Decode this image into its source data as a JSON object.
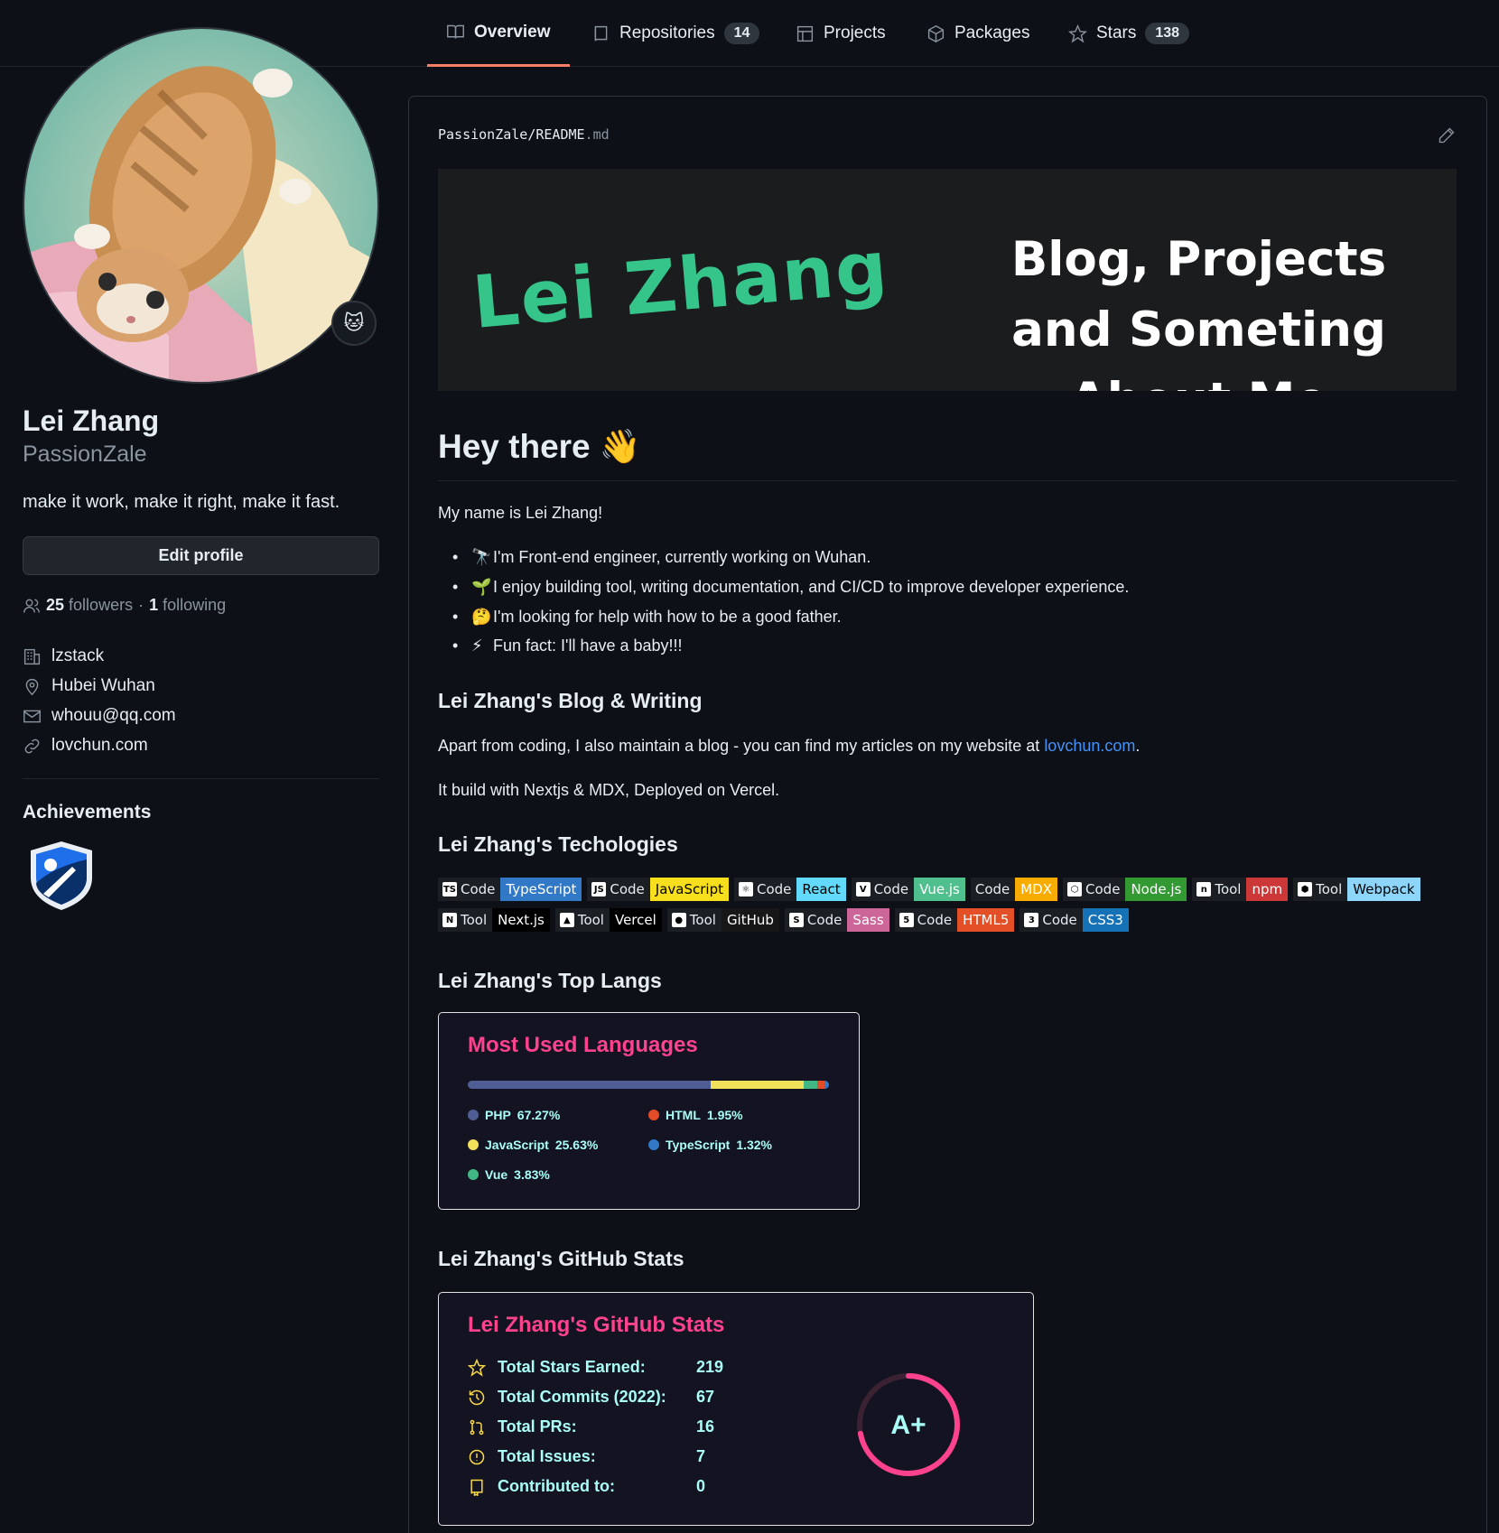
{
  "nav": {
    "tabs": [
      {
        "label": "Overview",
        "count": "",
        "icon": "book-icon",
        "active": true
      },
      {
        "label": "Repositories",
        "count": "14",
        "icon": "repo-icon"
      },
      {
        "label": "Projects",
        "count": "",
        "icon": "table-icon"
      },
      {
        "label": "Packages",
        "count": "",
        "icon": "package-icon"
      },
      {
        "label": "Stars",
        "count": "138",
        "icon": "star-icon"
      }
    ]
  },
  "profile": {
    "full_name": "Lei Zhang",
    "username": "PassionZale",
    "bio": "make it work, make it right, make it fast.",
    "edit_label": "Edit profile",
    "followers_count": "25",
    "followers_label": "followers",
    "separator": "·",
    "following_count": "1",
    "following_label": "following",
    "company": "lzstack",
    "location": "Hubei Wuhan",
    "email": "whouu@qq.com",
    "website": "lovchun.com",
    "achievements_title": "Achievements"
  },
  "readme": {
    "owner": "PassionZale",
    "slash": "/",
    "file": "README",
    "ext": ".md",
    "banner_name": "Lei  Zhang",
    "banner_tagline": "Blog, Projects and Someting About Me",
    "greeting": "Hey there 👋",
    "intro": "My name is Lei Zhang!",
    "bullets": [
      {
        "icon": "🔭",
        "text": "I'm Front-end engineer, currently working on Wuhan."
      },
      {
        "icon": "🌱",
        "text": "I enjoy building tool, writing documentation, and CI/CD to improve developer experience."
      },
      {
        "icon": "🤔",
        "text": "I'm looking for help with how to be a good father."
      },
      {
        "icon": "⚡",
        "text": "Fun fact: I'll have a baby!!!"
      }
    ],
    "blog_heading": "Lei Zhang's Blog & Writing",
    "blog_text_before": "Apart from coding, I also maintain a blog - you can find my articles on my website at ",
    "blog_link": "lovchun.com",
    "blog_text_after": ".",
    "build_text": "It build with Nextjs & MDX, Deployed on Vercel.",
    "tech_heading": "Lei Zhang's Techologies",
    "techs_row1": [
      {
        "kind": "Code",
        "name": "TypeScript",
        "color": "#3178c6",
        "logo": "TS"
      },
      {
        "kind": "Code",
        "name": "JavaScript",
        "color": "#f7df1e",
        "text_color": "#000",
        "logo": "JS"
      },
      {
        "kind": "Code",
        "name": "React",
        "color": "#61dafb",
        "text_color": "#000",
        "logo": "⚛"
      },
      {
        "kind": "Code",
        "name": "Vue.js",
        "color": "#4fc08d",
        "logo": "V"
      },
      {
        "kind": "Code",
        "name": "MDX",
        "color": "#f9ac00",
        "logo": ""
      },
      {
        "kind": "Code",
        "name": "Node.js",
        "color": "#339933",
        "logo": "⬡"
      },
      {
        "kind": "Tool",
        "name": "npm",
        "color": "#cb3837",
        "logo": "n"
      },
      {
        "kind": "Tool",
        "name": "Webpack",
        "color": "#8dd6f9",
        "text_color": "#000",
        "logo": "⬢"
      }
    ],
    "techs_row2": [
      {
        "kind": "Tool",
        "name": "Next.js",
        "color": "#000000",
        "logo": "N"
      },
      {
        "kind": "Tool",
        "name": "Vercel",
        "color": "#000000",
        "logo": "▲"
      },
      {
        "kind": "Tool",
        "name": "GitHub",
        "color": "#181717",
        "logo": "●"
      },
      {
        "kind": "Code",
        "name": "Sass",
        "color": "#cc6699",
        "logo": "S"
      },
      {
        "kind": "Code",
        "name": "HTML5",
        "color": "#e34f26",
        "logo": "5"
      },
      {
        "kind": "Code",
        "name": "CSS3",
        "color": "#1572b6",
        "logo": "3"
      }
    ],
    "langs_heading": "Lei Zhang's Top Langs",
    "langs_card": {
      "title": "Most Used Languages",
      "languages": [
        {
          "name": "PHP",
          "percent": 67.27,
          "color": "#4f5d95"
        },
        {
          "name": "JavaScript",
          "percent": 25.63,
          "color": "#f1e05a"
        },
        {
          "name": "Vue",
          "percent": 3.83,
          "color": "#41b883"
        },
        {
          "name": "HTML",
          "percent": 1.95,
          "color": "#e34c26"
        },
        {
          "name": "TypeScript",
          "percent": 1.32,
          "color": "#3178c6"
        }
      ]
    },
    "stats_heading": "Lei Zhang's GitHub Stats",
    "stats_card": {
      "title": "Lei Zhang's GitHub Stats",
      "rows": [
        {
          "label": "Total Stars Earned:",
          "value": "219",
          "icon": "star-icon"
        },
        {
          "label": "Total Commits (2022):",
          "value": "67",
          "icon": "history-icon"
        },
        {
          "label": "Total PRs:",
          "value": "16",
          "icon": "pull-request-icon"
        },
        {
          "label": "Total Issues:",
          "value": "7",
          "icon": "issue-icon"
        },
        {
          "label": "Contributed to:",
          "value": "0",
          "icon": "repo-icon"
        }
      ],
      "grade": "A+",
      "grade_progress": 0.72
    }
  }
}
